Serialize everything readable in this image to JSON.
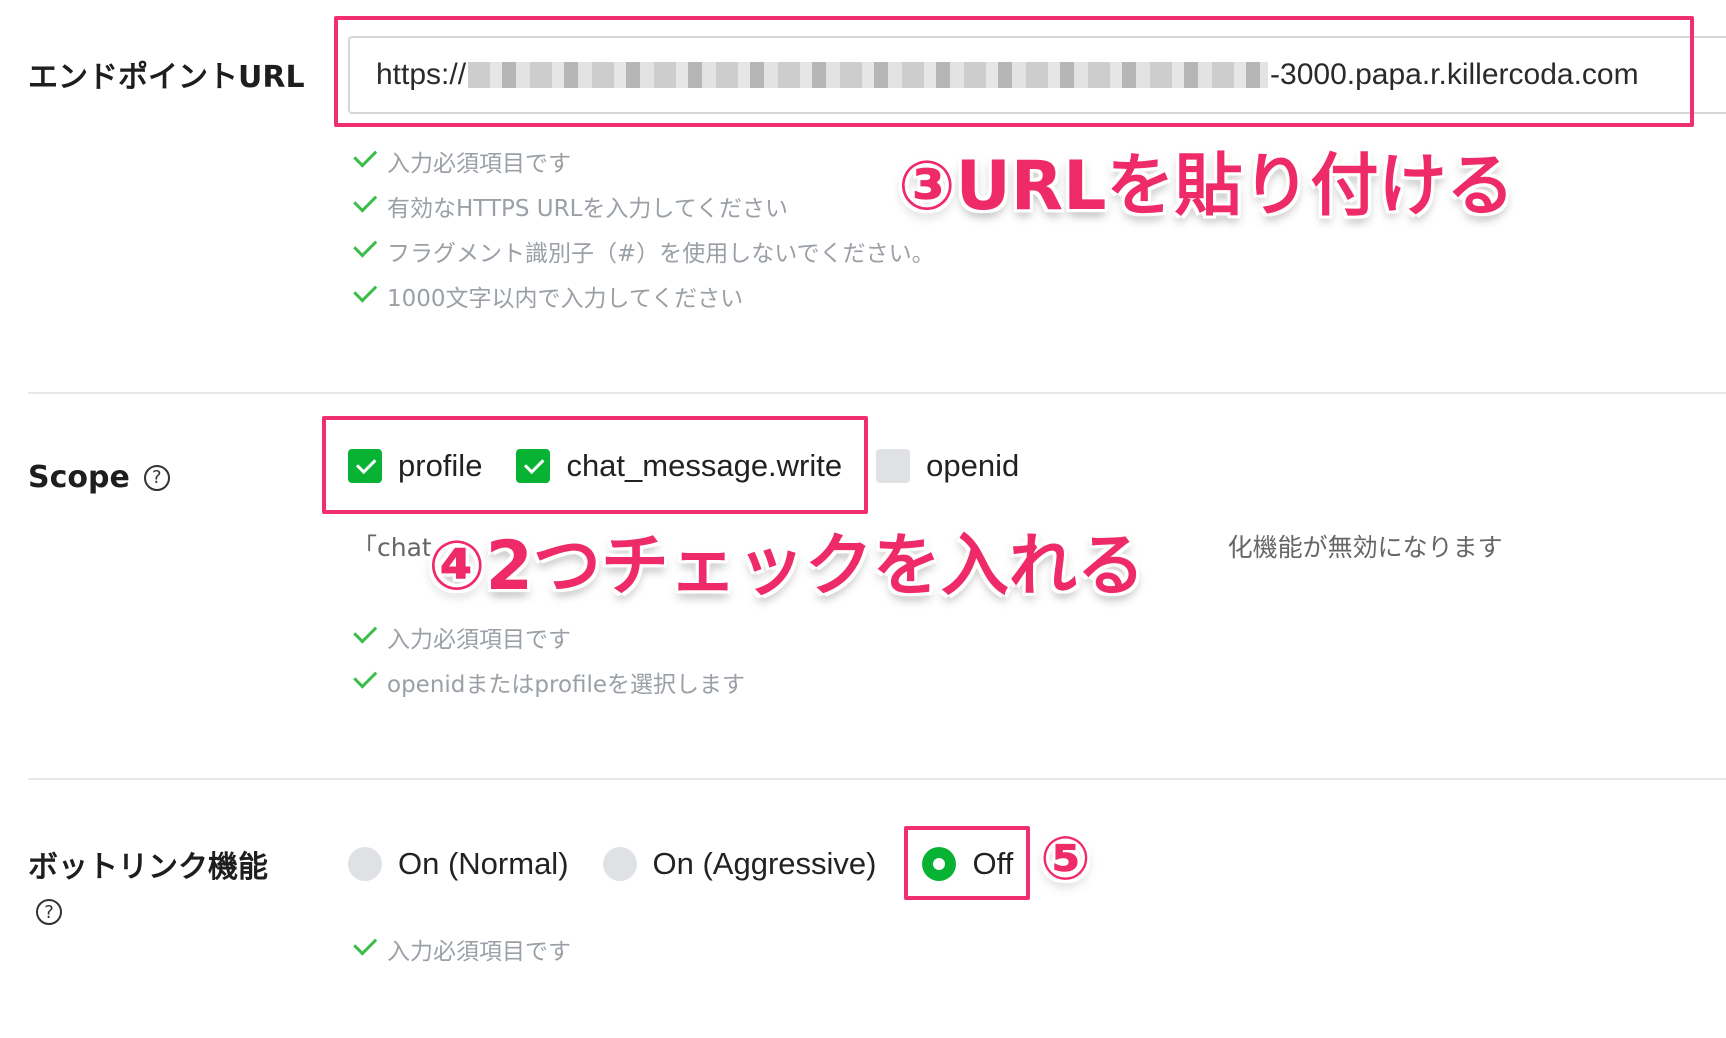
{
  "endpoint": {
    "label": "エンドポイントURL",
    "url_prefix": "https://",
    "url_suffix": "-3000.papa.r.killercoda.com",
    "hints": [
      "入力必須項目です",
      "有効なHTTPS URLを入力してください",
      "フラグメント識別子（#）を使用しないでください。",
      "1000文字以内で入力してください"
    ]
  },
  "scope": {
    "label": "Scope",
    "options": [
      {
        "label": "profile",
        "checked": true
      },
      {
        "label": "chat_message.write",
        "checked": true
      },
      {
        "label": "openid",
        "checked": false
      }
    ],
    "note_start": "「chat",
    "note_end": "化機能が無効になります",
    "hints": [
      "入力必須項目です",
      "openidまたはprofileを選択します"
    ]
  },
  "bot_link": {
    "label": "ボットリンク機能",
    "options": [
      {
        "label": "On (Normal)",
        "selected": false
      },
      {
        "label": "On (Aggressive)",
        "selected": false
      },
      {
        "label": "Off",
        "selected": true
      }
    ],
    "hints": [
      "入力必須項目です"
    ]
  },
  "annotations": {
    "step3": "③URLを貼り付ける",
    "step4": "④2つチェックを入れる",
    "step5": "⑤"
  },
  "colors": {
    "accent_green": "#08b333",
    "annotation_pink": "#f0306e",
    "hint_gray": "#9aa0a6"
  }
}
